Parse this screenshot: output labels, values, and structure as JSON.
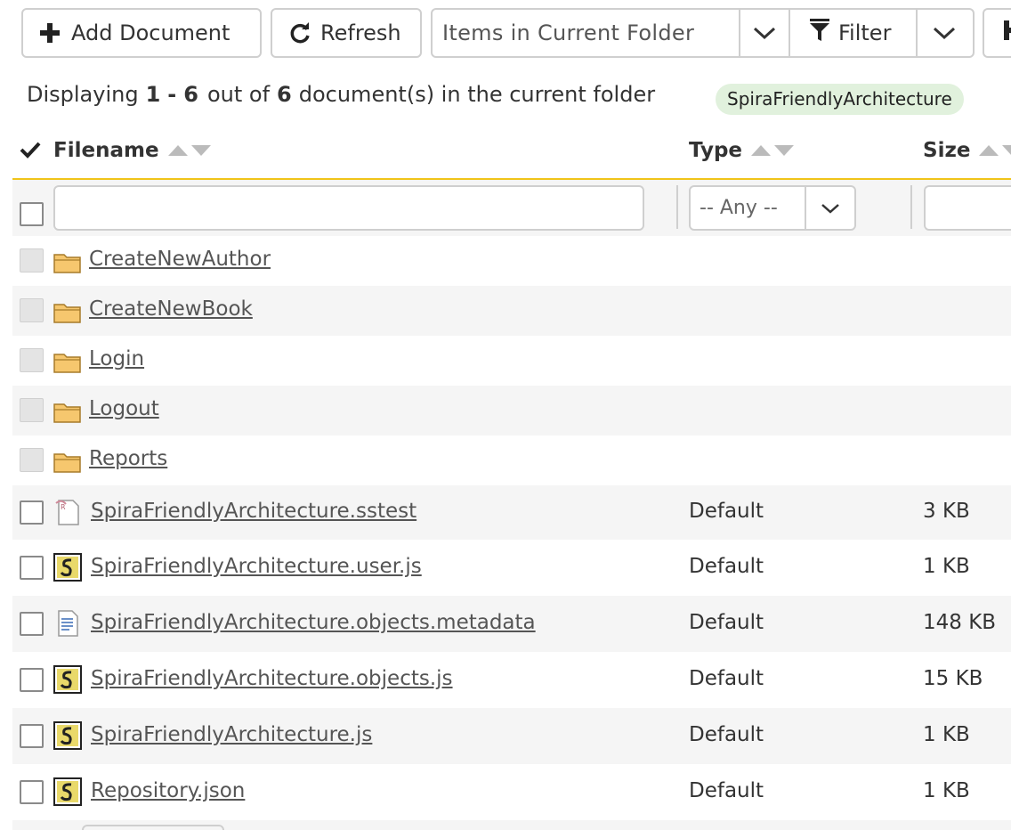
{
  "toolbar": {
    "add_label": "Add Document",
    "refresh_label": "Refresh",
    "view_select": "Items in Current Folder",
    "filter_label": "Filter"
  },
  "summary": {
    "prefix": "Displaying",
    "from": "1",
    "dash": "-",
    "to": "6",
    "mid": "out of",
    "total": "6",
    "suffix": "document(s) in the current folder",
    "tag": "SpiraFriendlyArchitecture"
  },
  "columns": {
    "filename": "Filename",
    "type": "Type",
    "size": "Size"
  },
  "filters": {
    "type_select": "-- Any --"
  },
  "folders": [
    {
      "name": "CreateNewAuthor"
    },
    {
      "name": "CreateNewBook"
    },
    {
      "name": "Login"
    },
    {
      "name": "Logout"
    },
    {
      "name": "Reports"
    }
  ],
  "documents": [
    {
      "name": "SpiraFriendlyArchitecture.sstest",
      "type": "Default",
      "size": "3 KB",
      "icon": "sstest-file-icon"
    },
    {
      "name": "SpiraFriendlyArchitecture.user.js",
      "type": "Default",
      "size": "1 KB",
      "icon": "script-file-icon"
    },
    {
      "name": "SpiraFriendlyArchitecture.objects.metadata",
      "type": "Default",
      "size": "148 KB",
      "icon": "text-file-icon"
    },
    {
      "name": "SpiraFriendlyArchitecture.objects.js",
      "type": "Default",
      "size": "15 KB",
      "icon": "script-file-icon"
    },
    {
      "name": "SpiraFriendlyArchitecture.js",
      "type": "Default",
      "size": "1 KB",
      "icon": "script-file-icon"
    },
    {
      "name": "Repository.json",
      "type": "Default",
      "size": "1 KB",
      "icon": "script-file-icon"
    }
  ],
  "colors": {
    "header_rule": "#f0c419",
    "tag_bg": "#e1f1dd",
    "row_alt": "#f5f5f5",
    "folder": "#f6c76e"
  }
}
